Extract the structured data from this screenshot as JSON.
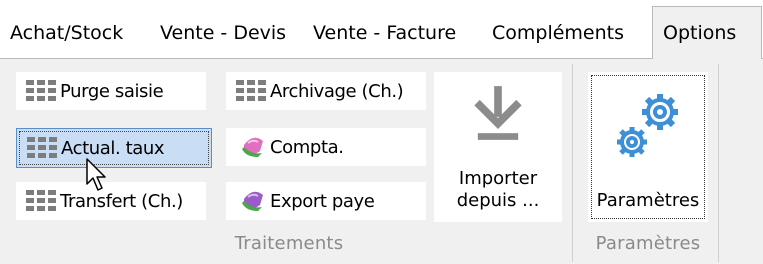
{
  "tabs": [
    {
      "label": "Achat/Stock"
    },
    {
      "label": "Vente - Devis"
    },
    {
      "label": "Vente - Facture"
    },
    {
      "label": "Compléments"
    },
    {
      "label": "Options",
      "active": true
    }
  ],
  "groups": {
    "traitements": {
      "label": "Traitements",
      "buttons": {
        "purge": "Purge saisie",
        "archivage": "Archivage (Ch.)",
        "actual": "Actual. taux",
        "compta": "Compta.",
        "transfert": "Transfert (Ch.)",
        "export": "Export paye",
        "importer_line1": "Importer",
        "importer_line2": "depuis ..."
      }
    },
    "parametres": {
      "label": "Paramètres",
      "button": "Paramètres"
    }
  },
  "icons": {
    "grid": "grid-icon",
    "gem": "gem-icon",
    "download": "download-arrow-icon",
    "gears": "gears-icon"
  },
  "colors": {
    "selected_bg": "#c9def5",
    "selected_border": "#5b8fc9",
    "gear_blue": "#3d8fd6",
    "gem_pink": "#e06fc0",
    "gem_green": "#4aa84a"
  }
}
